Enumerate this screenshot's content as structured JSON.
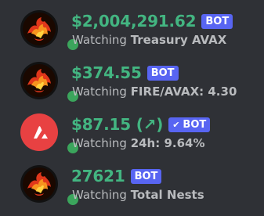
{
  "colors": {
    "background": "#2f3136",
    "name_green": "#43b581",
    "bot_tag": "#5865f2",
    "status_online": "#3ba55c",
    "activity_gray": "#b9bbbe",
    "avax_red": "#e84142"
  },
  "members": [
    {
      "name": "$2,004,291.62",
      "tag": "BOT",
      "verified": false,
      "activity_prefix": "Watching",
      "activity_value": "Treasury AVAX",
      "avatar_icon": "phoenix-fire-icon",
      "status": "online"
    },
    {
      "name": "$374.55",
      "tag": "BOT",
      "verified": false,
      "activity_prefix": "Watching",
      "activity_value": "FIRE/AVAX: 4.30",
      "avatar_icon": "phoenix-fire-icon",
      "status": "online"
    },
    {
      "name": "$87.15 (↗)",
      "tag": "BOT",
      "tag_check": "✔",
      "verified": true,
      "activity_prefix": "Watching",
      "activity_value": "24h: 9.64%",
      "avatar_icon": "avalanche-logo-icon",
      "status": "online"
    },
    {
      "name": "27621",
      "tag": "BOT",
      "verified": false,
      "activity_prefix": "Watching",
      "activity_value": "Total Nests",
      "avatar_icon": "phoenix-fire-icon",
      "status": "online"
    }
  ]
}
